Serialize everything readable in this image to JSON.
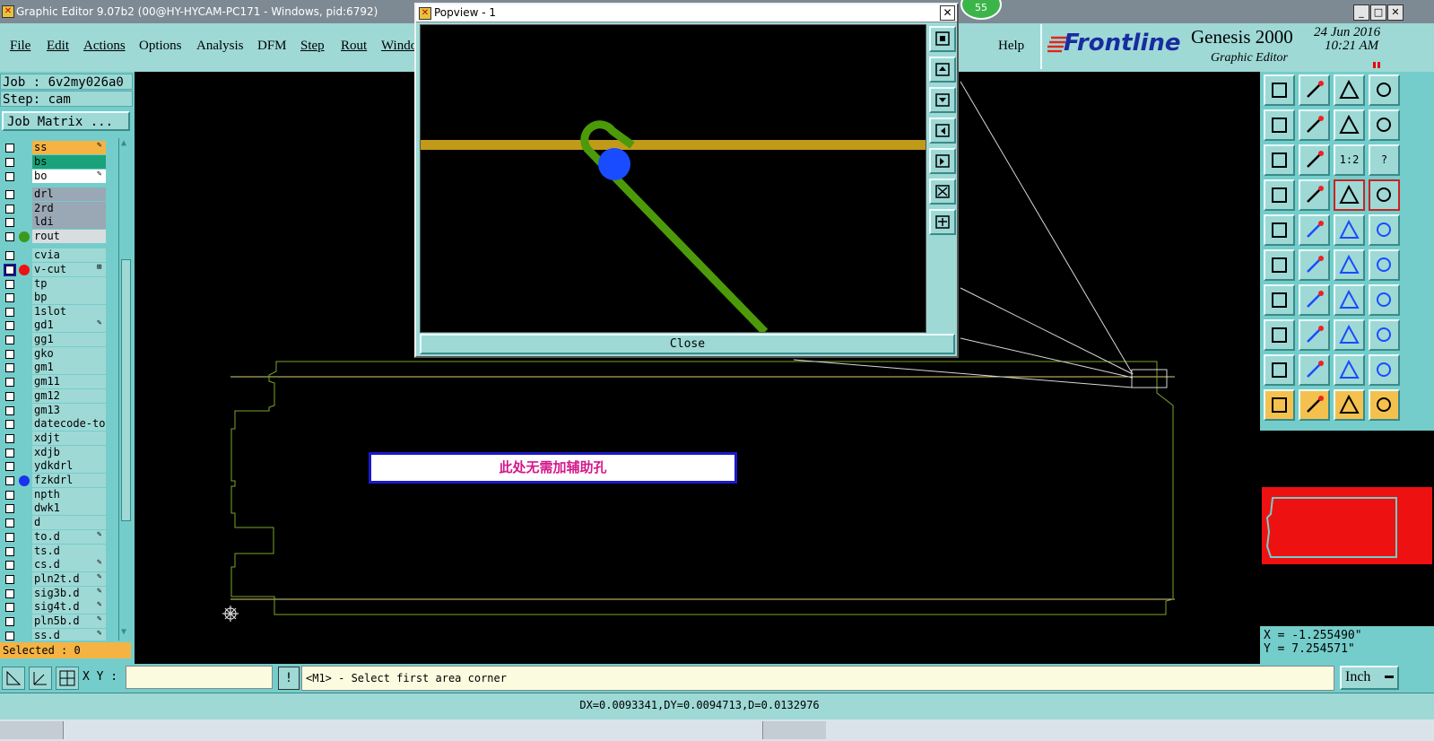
{
  "app": {
    "title": "Graphic Editor 9.07b2 (00@HY-HYCAM-PC171 - Windows, pid:6792)",
    "badge": "55"
  },
  "menu": {
    "file": "File",
    "edit": "Edit",
    "actions": "Actions",
    "options": "Options",
    "analysis": "Analysis",
    "dfm": "DFM",
    "step": "Step",
    "rout": "Rout",
    "window": "Windo",
    "help": "Help"
  },
  "brand": {
    "logo": "Frontline",
    "product": "Genesis 2000",
    "subtitle": "Graphic Editor",
    "date": "24 Jun 2016",
    "time": "10:21 AM"
  },
  "job": {
    "job_line": "Job : 6v2my026a0",
    "step_line": "Step: cam",
    "matrix_button": "Job Matrix ..."
  },
  "layers": [
    {
      "name": "ss",
      "bg": "#f4b343",
      "mark": "✎"
    },
    {
      "name": "bs",
      "bg": "#1aa37a",
      "mark": ""
    },
    {
      "name": "bo",
      "bg": "#ffffff",
      "mark": "✎"
    },
    {
      "name": "drl",
      "bg": "#9aa7b4",
      "mark": ""
    },
    {
      "name": "2rd",
      "bg": "#9aa7b4",
      "mark": ""
    },
    {
      "name": "ldi",
      "bg": "#9aa7b4",
      "mark": ""
    },
    {
      "name": "rout",
      "bg": "#d8dde0",
      "mark": "",
      "dot": "#3a9a1a"
    },
    {
      "name": "cvia",
      "bg": "#9ed9d6",
      "mark": ""
    },
    {
      "name": "v-cut",
      "bg": "#9ed9d6",
      "mark": "⊞",
      "dot": "#ee1111",
      "checked": true
    },
    {
      "name": "tp",
      "bg": "#9ed9d6",
      "mark": ""
    },
    {
      "name": "bp",
      "bg": "#9ed9d6",
      "mark": ""
    },
    {
      "name": "1slot",
      "bg": "#9ed9d6",
      "mark": ""
    },
    {
      "name": "gd1",
      "bg": "#9ed9d6",
      "mark": "✎"
    },
    {
      "name": "gg1",
      "bg": "#9ed9d6",
      "mark": ""
    },
    {
      "name": "gko",
      "bg": "#9ed9d6",
      "mark": ""
    },
    {
      "name": "gm1",
      "bg": "#9ed9d6",
      "mark": ""
    },
    {
      "name": "gm11",
      "bg": "#9ed9d6",
      "mark": ""
    },
    {
      "name": "gm12",
      "bg": "#9ed9d6",
      "mark": ""
    },
    {
      "name": "gm13",
      "bg": "#9ed9d6",
      "mark": ""
    },
    {
      "name": "datecode-to",
      "bg": "#9ed9d6",
      "mark": ""
    },
    {
      "name": "xdjt",
      "bg": "#9ed9d6",
      "mark": ""
    },
    {
      "name": "xdjb",
      "bg": "#9ed9d6",
      "mark": ""
    },
    {
      "name": "ydkdrl",
      "bg": "#9ed9d6",
      "mark": ""
    },
    {
      "name": "fzkdrl",
      "bg": "#9ed9d6",
      "mark": "",
      "dot": "#1a33ee"
    },
    {
      "name": "npth",
      "bg": "#9ed9d6",
      "mark": ""
    },
    {
      "name": "dwk1",
      "bg": "#9ed9d6",
      "mark": ""
    },
    {
      "name": "d",
      "bg": "#9ed9d6",
      "mark": ""
    },
    {
      "name": "to.d",
      "bg": "#9ed9d6",
      "mark": "✎"
    },
    {
      "name": "ts.d",
      "bg": "#9ed9d6",
      "mark": ""
    },
    {
      "name": "cs.d",
      "bg": "#9ed9d6",
      "mark": "✎"
    },
    {
      "name": "pln2t.d",
      "bg": "#9ed9d6",
      "mark": "✎"
    },
    {
      "name": "sig3b.d",
      "bg": "#9ed9d6",
      "mark": "✎"
    },
    {
      "name": "sig4t.d",
      "bg": "#9ed9d6",
      "mark": "✎"
    },
    {
      "name": "pln5b.d",
      "bg": "#9ed9d6",
      "mark": "✎"
    },
    {
      "name": "ss.d",
      "bg": "#9ed9d6",
      "mark": "✎"
    }
  ],
  "selected": "Selected : 0",
  "popview": {
    "title": "Popview - 1",
    "close": "Close"
  },
  "note": "此处无需加辅助孔",
  "right_toolbar": {
    "label_12": "1:2",
    "label_q": "?"
  },
  "coords": {
    "x": "X = -1.255490\"",
    "y": "Y = 7.254571\""
  },
  "command": {
    "xy_label": "X Y :",
    "xy_value": "",
    "prompt": "<M1> - Select first area corner",
    "units": "Inch"
  },
  "status": "DX=0.0093341,DY=0.0094713,D=0.0132976",
  "colors": {
    "panel": "#74cdca",
    "panel_light": "#9ed9d6",
    "note_text": "#d4188c",
    "overview_red": "#ee1111",
    "rout_green": "#3a9a1a",
    "pad_blue": "#1a4cff",
    "trace_gold": "#c29a1a"
  }
}
